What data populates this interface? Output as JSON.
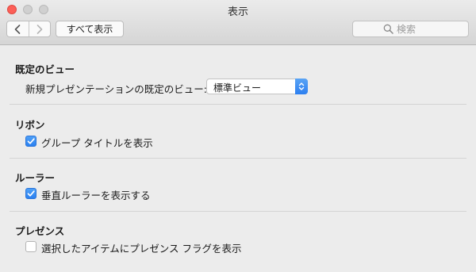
{
  "window": {
    "title": "表示"
  },
  "toolbar": {
    "show_all_label": "すべて表示",
    "search_placeholder": "検索"
  },
  "sections": {
    "default_view": {
      "title": "既定のビュー",
      "label": "新規プレゼンテーションの既定のビュー:",
      "selected": "標準ビュー"
    },
    "ribbon": {
      "title": "リボン",
      "checkbox_label": "グループ タイトルを表示",
      "checked": true
    },
    "ruler": {
      "title": "ルーラー",
      "checkbox_label": "垂直ルーラーを表示する",
      "checked": true
    },
    "presence": {
      "title": "プレゼンス",
      "checkbox_label": "選択したアイテムにプレゼンス フラグを表示",
      "checked": false
    }
  },
  "colors": {
    "accent": "#2d7ff0",
    "close": "#fc5f57"
  },
  "icons": [
    "close-icon",
    "minimize-icon",
    "zoom-icon",
    "back-chevron-icon",
    "forward-chevron-icon",
    "search-icon",
    "popup-stepper-icon",
    "checkmark-icon"
  ]
}
